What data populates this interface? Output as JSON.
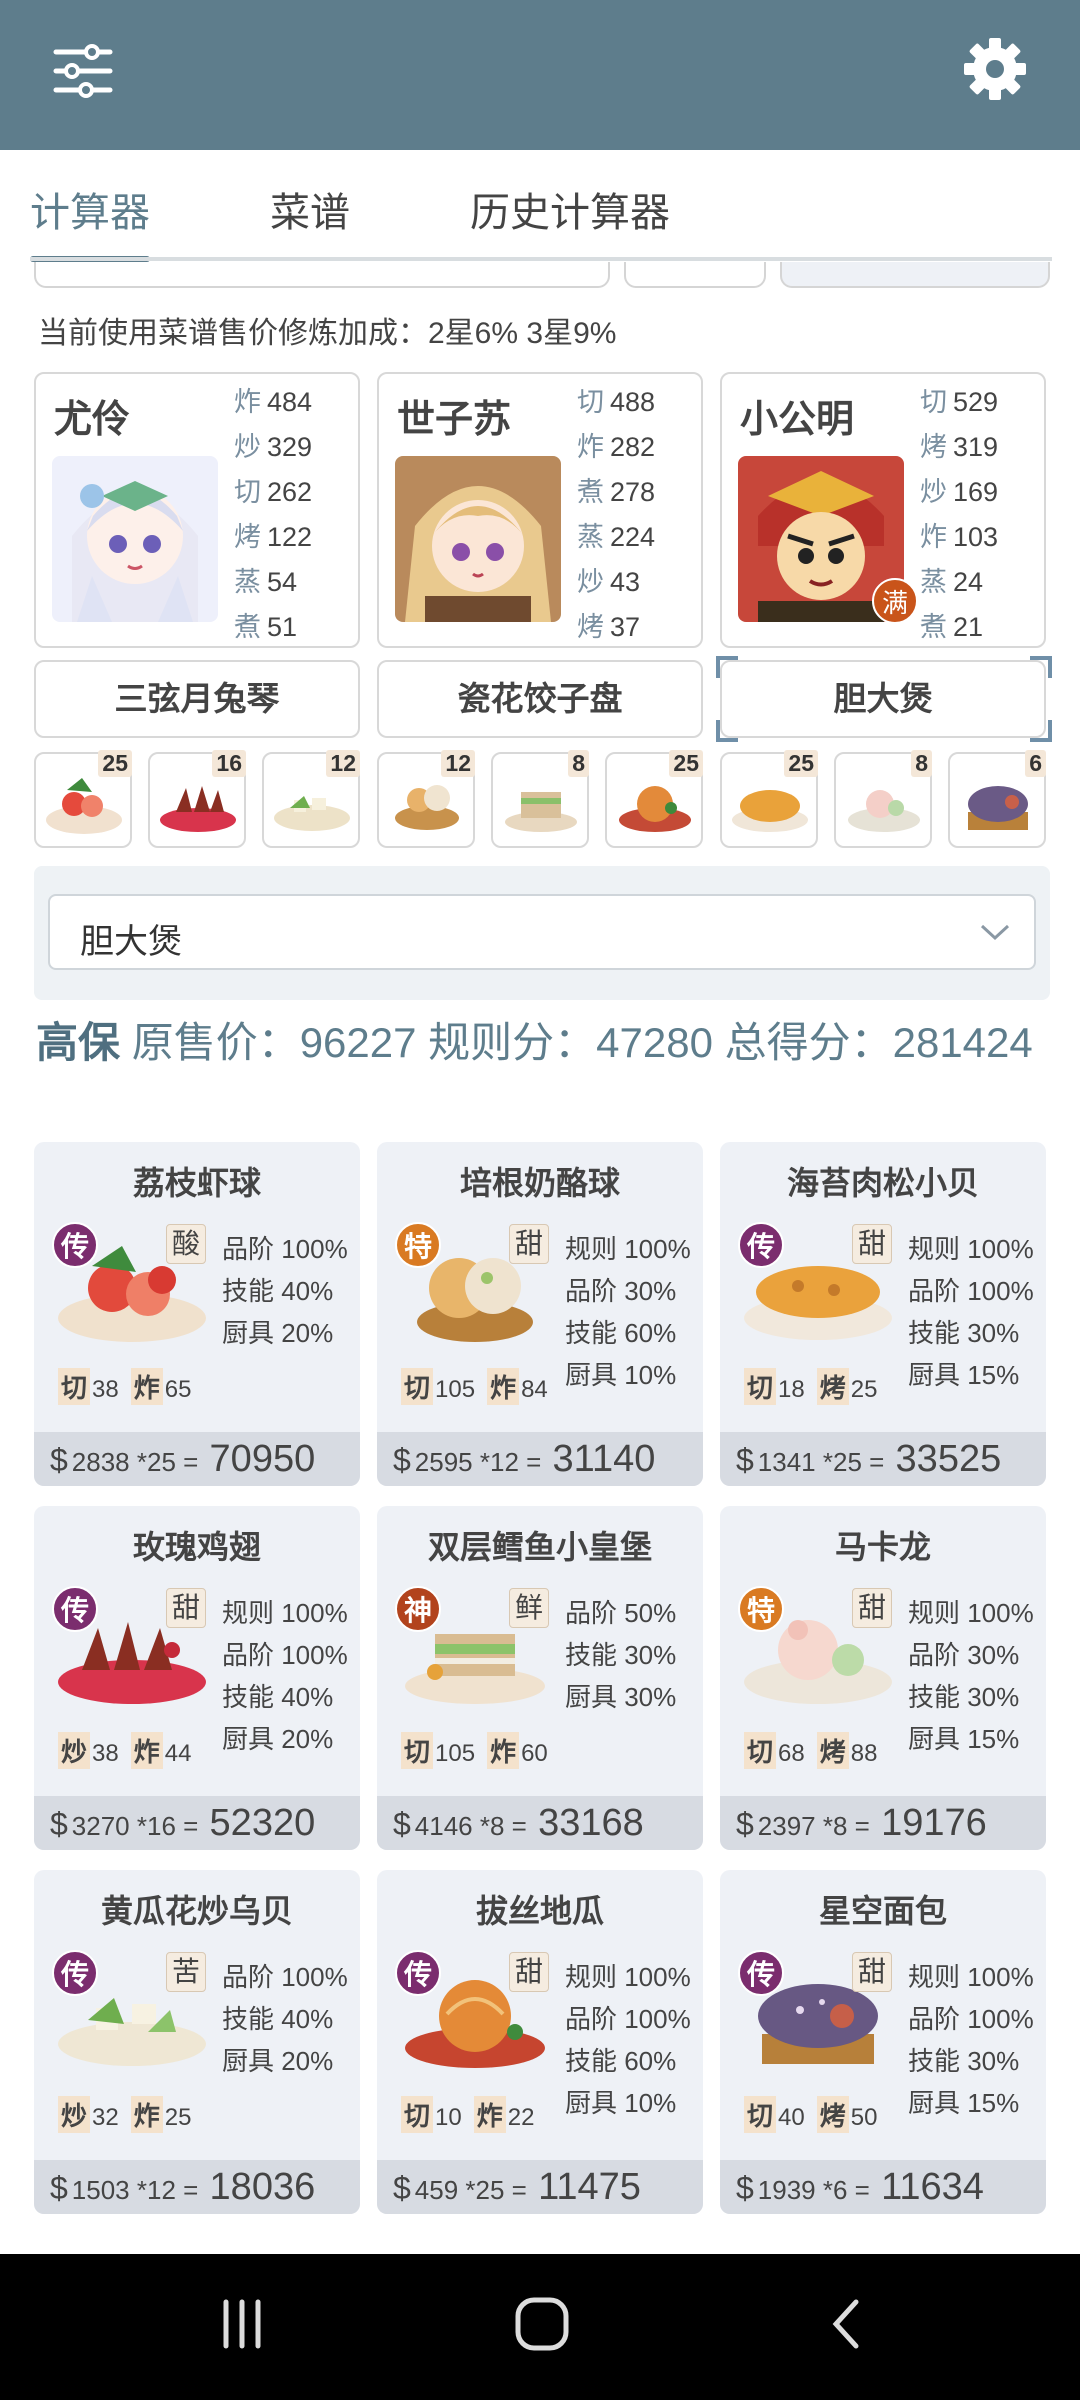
{
  "tabs": [
    {
      "label": "计算器"
    },
    {
      "label": "菜谱"
    },
    {
      "label": "历史计算器"
    }
  ],
  "bonus_text": "当前使用菜谱售价修炼加成：2星6% 3星9%",
  "chefs": [
    {
      "name": "尤伶",
      "stats": [
        {
          "k": "炸",
          "v": "484"
        },
        {
          "k": "炒",
          "v": "329"
        },
        {
          "k": "切",
          "v": "262"
        },
        {
          "k": "烤",
          "v": "122"
        },
        {
          "k": "蒸",
          "v": "54"
        },
        {
          "k": "煮",
          "v": "51"
        }
      ]
    },
    {
      "name": "世子苏",
      "stats": [
        {
          "k": "切",
          "v": "488"
        },
        {
          "k": "炸",
          "v": "282"
        },
        {
          "k": "煮",
          "v": "278"
        },
        {
          "k": "蒸",
          "v": "224"
        },
        {
          "k": "炒",
          "v": "43"
        },
        {
          "k": "烤",
          "v": "37"
        }
      ]
    },
    {
      "name": "小公明",
      "badge": "满",
      "stats": [
        {
          "k": "切",
          "v": "529"
        },
        {
          "k": "烤",
          "v": "319"
        },
        {
          "k": "炒",
          "v": "169"
        },
        {
          "k": "炸",
          "v": "103"
        },
        {
          "k": "蒸",
          "v": "24"
        },
        {
          "k": "煮",
          "v": "21"
        }
      ]
    }
  ],
  "equipment": [
    "三弦月兔琴",
    "瓷花饺子盘",
    "胆大煲"
  ],
  "dish_counts": [
    "25",
    "16",
    "12",
    "12",
    "8",
    "25",
    "25",
    "8",
    "6"
  ],
  "select": {
    "value": "胆大煲"
  },
  "summary": {
    "name": "高保",
    "text": "原售价：96227 规则分：47280 总得分：281424"
  },
  "recipes": [
    {
      "title": "荔枝虾球",
      "rank": "传",
      "rank_class": "chuan",
      "flavor": "酸",
      "reqs": [
        "品阶 100%",
        "技能 40%",
        "厨具 20%"
      ],
      "skills": [
        {
          "k": "切",
          "v": "38"
        },
        {
          "k": "炸",
          "v": "65"
        }
      ],
      "price": "2838 *25",
      "total": "70950"
    },
    {
      "title": "培根奶酪球",
      "rank": "特",
      "rank_class": "te",
      "flavor": "甜",
      "reqs": [
        "规则 100%",
        "品阶 30%",
        "技能 60%",
        "厨具 10%"
      ],
      "skills": [
        {
          "k": "切",
          "v": "105"
        },
        {
          "k": "炸",
          "v": "84"
        }
      ],
      "price": "2595 *12",
      "total": "31140"
    },
    {
      "title": "海苔肉松小贝",
      "rank": "传",
      "rank_class": "chuan",
      "flavor": "甜",
      "reqs": [
        "规则 100%",
        "品阶 100%",
        "技能 30%",
        "厨具 15%"
      ],
      "skills": [
        {
          "k": "切",
          "v": "18"
        },
        {
          "k": "烤",
          "v": "25"
        }
      ],
      "price": "1341 *25",
      "total": "33525"
    },
    {
      "title": "玫瑰鸡翅",
      "rank": "传",
      "rank_class": "chuan",
      "flavor": "甜",
      "reqs": [
        "规则 100%",
        "品阶 100%",
        "技能 40%",
        "厨具 20%"
      ],
      "skills": [
        {
          "k": "炒",
          "v": "38"
        },
        {
          "k": "炸",
          "v": "44"
        }
      ],
      "price": "3270 *16",
      "total": "52320"
    },
    {
      "title": "双层鳕鱼小皇堡",
      "rank": "神",
      "rank_class": "shen",
      "flavor": "鲜",
      "reqs": [
        "品阶 50%",
        "技能 30%",
        "厨具 30%"
      ],
      "skills": [
        {
          "k": "切",
          "v": "105"
        },
        {
          "k": "炸",
          "v": "60"
        }
      ],
      "price": "4146 *8",
      "total": "33168"
    },
    {
      "title": "马卡龙",
      "rank": "特",
      "rank_class": "te",
      "flavor": "甜",
      "reqs": [
        "规则 100%",
        "品阶 30%",
        "技能 30%",
        "厨具 15%"
      ],
      "skills": [
        {
          "k": "切",
          "v": "68"
        },
        {
          "k": "烤",
          "v": "88"
        }
      ],
      "price": "2397 *8",
      "total": "19176"
    },
    {
      "title": "黄瓜花炒乌贝",
      "rank": "传",
      "rank_class": "chuan",
      "flavor": "苦",
      "reqs": [
        "品阶 100%",
        "技能 40%",
        "厨具 20%"
      ],
      "skills": [
        {
          "k": "炒",
          "v": "32"
        },
        {
          "k": "炸",
          "v": "25"
        }
      ],
      "price": "1503 *12",
      "total": "18036"
    },
    {
      "title": "拔丝地瓜",
      "rank": "传",
      "rank_class": "chuan",
      "flavor": "甜",
      "reqs": [
        "规则 100%",
        "品阶 100%",
        "技能 60%",
        "厨具 10%"
      ],
      "skills": [
        {
          "k": "切",
          "v": "10"
        },
        {
          "k": "炸",
          "v": "22"
        }
      ],
      "price": "459 *25",
      "total": "11475"
    },
    {
      "title": "星空面包",
      "rank": "传",
      "rank_class": "chuan",
      "flavor": "甜",
      "reqs": [
        "规则 100%",
        "品阶 100%",
        "技能 30%",
        "厨具 15%"
      ],
      "skills": [
        {
          "k": "切",
          "v": "40"
        },
        {
          "k": "烤",
          "v": "50"
        }
      ],
      "price": "1939 *6",
      "total": "11634"
    }
  ],
  "icons": {
    "menu": "sliders-icon",
    "settings": "gear-icon",
    "dropdown": "chevron-down-icon",
    "nav_recent": "recent-apps-icon",
    "nav_home": "home-icon",
    "nav_back": "back-icon"
  },
  "colors": {
    "primary": "#5e7d8c",
    "card_bg": "#eef1f6",
    "rank_chuan": "#7b2d6e",
    "rank_te": "#d97a22",
    "rank_shen": "#b2431d"
  }
}
